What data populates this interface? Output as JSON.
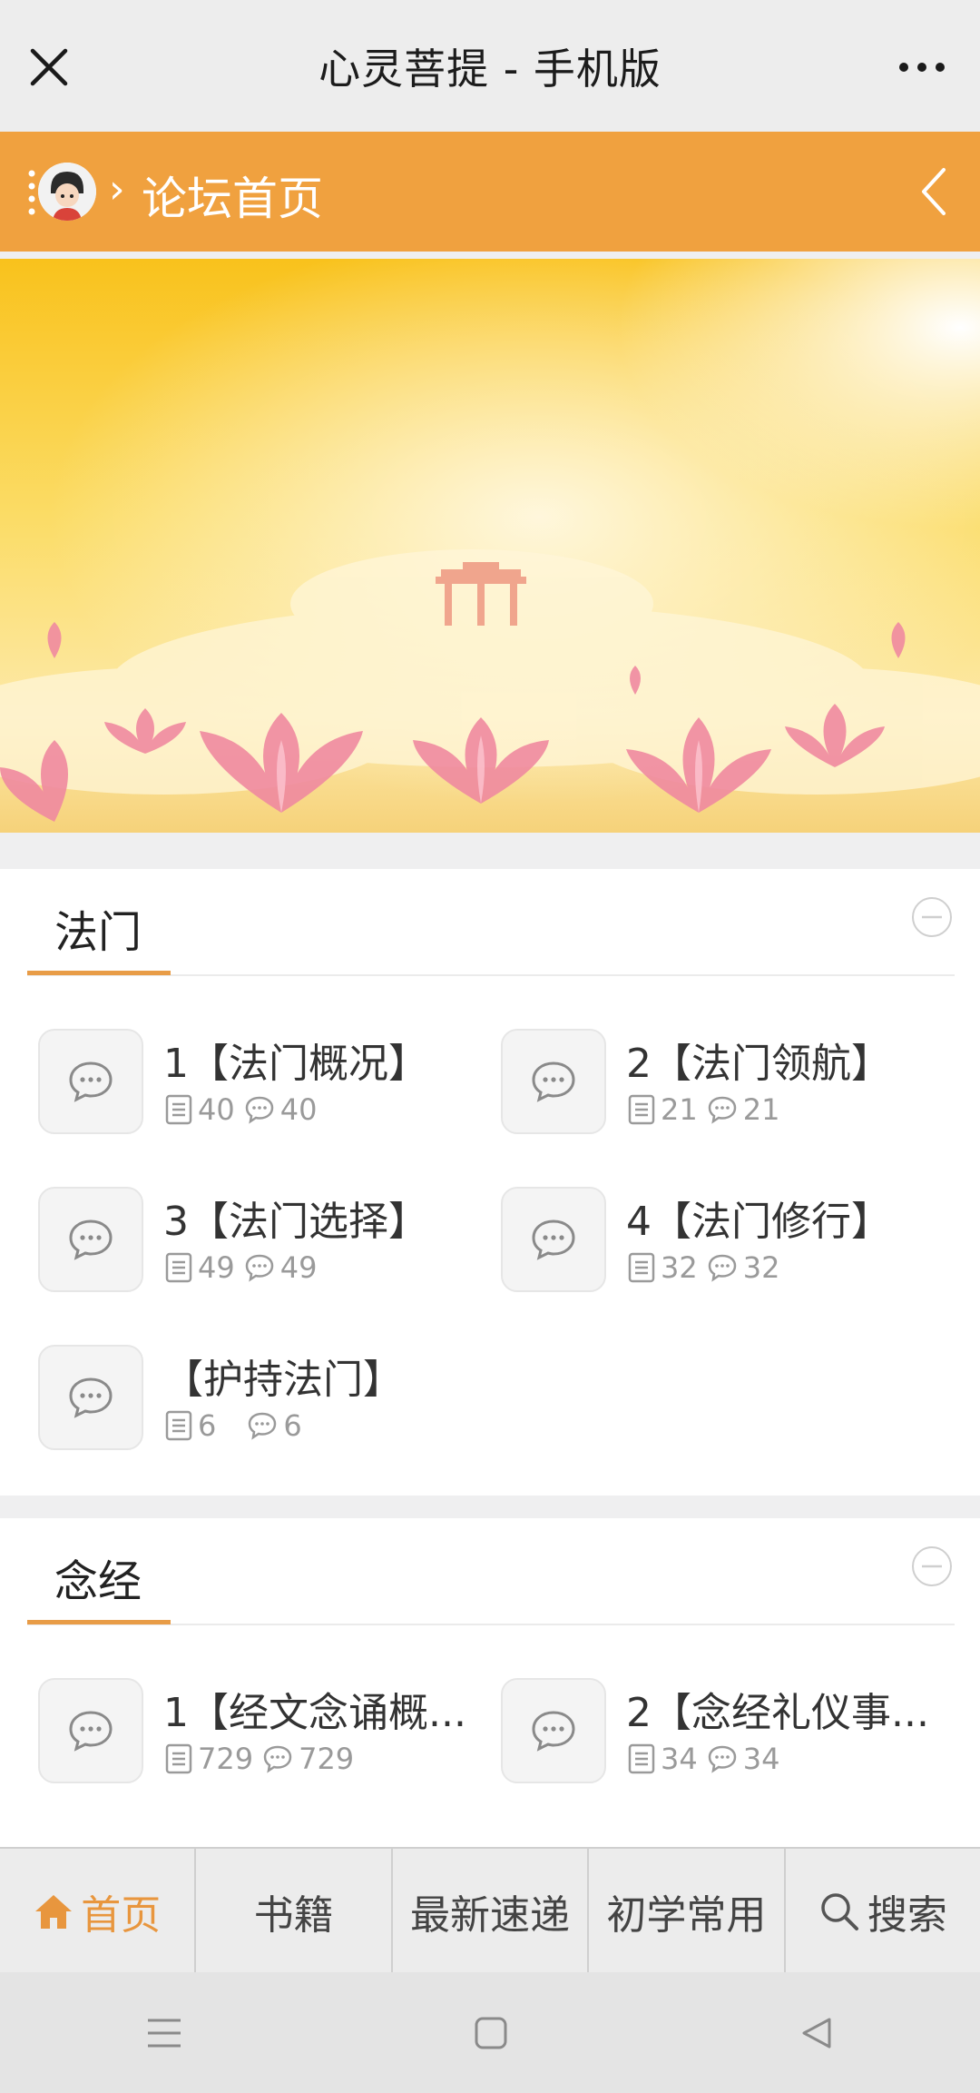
{
  "window": {
    "title": "心灵菩提 - 手机版"
  },
  "header": {
    "breadcrumb_sep": "›",
    "breadcrumb": "论坛首页"
  },
  "sections": [
    {
      "title": "法门",
      "forums": [
        {
          "name": "1【法门概况】",
          "threads": "40",
          "posts": "40"
        },
        {
          "name": "2【法门领航】",
          "threads": "21",
          "posts": "21"
        },
        {
          "name": "3【法门选择】",
          "threads": "49",
          "posts": "49"
        },
        {
          "name": "4【法门修行】",
          "threads": "32",
          "posts": "32"
        },
        {
          "name": "【护持法门】",
          "threads": "6",
          "posts": "6"
        }
      ]
    },
    {
      "title": "念经",
      "forums": [
        {
          "name": "1【经文念诵概...",
          "threads": "729",
          "posts": "729"
        },
        {
          "name": "2【念经礼仪事...",
          "threads": "34",
          "posts": "34"
        }
      ]
    }
  ],
  "bottom_nav": [
    {
      "label": "首页",
      "icon": "home-icon",
      "active": true
    },
    {
      "label": "书籍"
    },
    {
      "label": "最新速递"
    },
    {
      "label": "初学常用"
    },
    {
      "label": "搜索",
      "icon": "search-icon"
    }
  ],
  "colors": {
    "accent": "#f0a13f",
    "active_nav": "#e8963e",
    "underline": "#e89c47"
  }
}
